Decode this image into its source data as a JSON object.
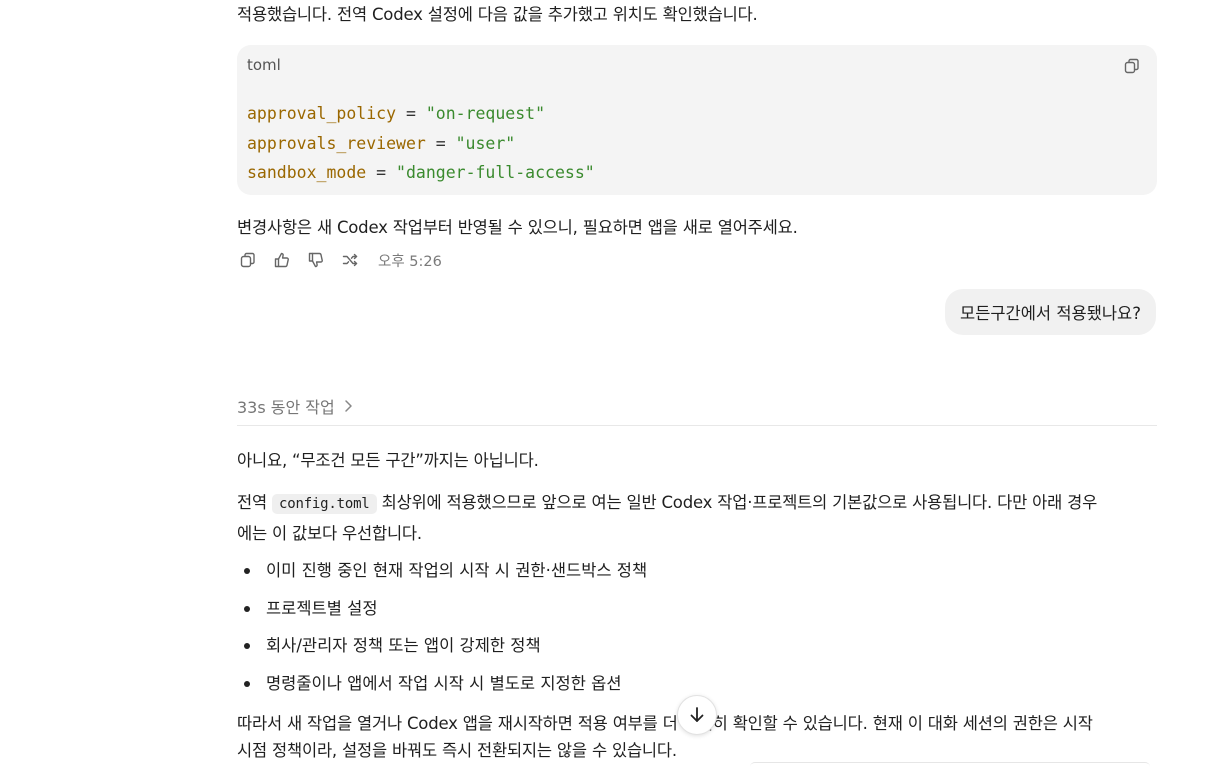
{
  "messages": {
    "top_line": "적용했습니다. 전역 Codex 설정에 다음 값을 추가했고 위치도 확인했습니다.",
    "code_block": {
      "language": "toml",
      "lines": [
        {
          "key": "approval_policy",
          "eq": "=",
          "value": "\"on-request\""
        },
        {
          "key": "approvals_reviewer",
          "eq": "=",
          "value": "\"user\""
        },
        {
          "key": "sandbox_mode",
          "eq": "=",
          "value": "\"danger-full-access\""
        }
      ]
    },
    "after_code": "변경사항은 새 Codex 작업부터 반영될 수 있으니, 필요하면 앱을 새로 열어주세요.",
    "timestamp": "오후 5:26",
    "user_bubble": "모든구간에서 적용됐나요?",
    "worked_label": "33s 동안 작업",
    "answer_line1": "아니요, “무조건 모든 구간”까지는 아닙니다.",
    "para2": {
      "prefix": "전역 ",
      "code": "config.toml",
      "suffix_line1": " 최상위에 적용했으므로 앞으로 여는 일반 Codex 작업·프로젝트의 기본값으로 사용됩니다. 다만 아래 경우",
      "line2": "에는 이 값보다 우선합니다."
    },
    "bullets": [
      "이미 진행 중인 현재 작업의 시작 시 권한·샌드박스 정책",
      "프로젝트별 설정",
      "회사/관리자 정책 또는 앱이 강제한 정책",
      "명령줄이나 앱에서 작업 시작 시 별도로 지정한 옵션"
    ],
    "final_line1": "따라서 새 작업을 열거나 Codex 앱을 재시작하면 적용 여부를 더 확실히 확인할 수 있습니다. 현재 이 대화 세션의 권한은 시작",
    "final_line2": "시점 정책이라, 설정을 바꿔도 즉시 전환되지는 않을 수 있습니다."
  },
  "icons": {
    "copy": "copy-icon",
    "like": "thumbs-up-icon",
    "dislike": "thumbs-down-icon",
    "share": "share-icon",
    "chevron": "chevron-right-icon",
    "scroll": "arrow-down-icon"
  }
}
